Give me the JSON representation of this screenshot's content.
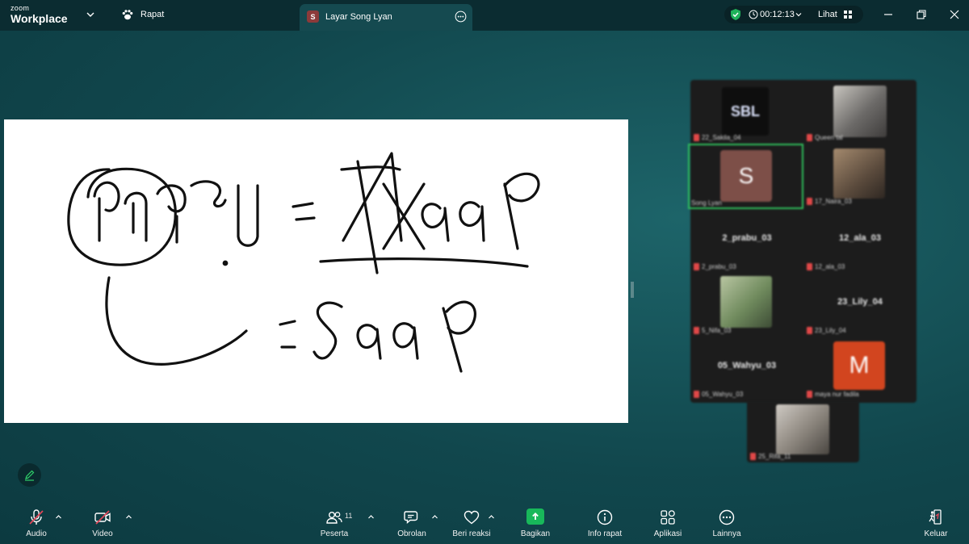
{
  "app": {
    "brand_top": "zoom",
    "brand_bottom": "Workplace",
    "meeting_tab": "Rapat",
    "share_tab": {
      "avatar_letter": "S",
      "label": "Layar Song Lyan"
    },
    "timer": "00:12:13",
    "view_label": "Lihat"
  },
  "whiteboard": {
    "lines": [
      "ករ​ការ​ = Thraap",
      "= Saap"
    ]
  },
  "gallery": {
    "tiles": [
      {
        "name": "22_Sakila_04",
        "logo_text": "SBL"
      },
      {
        "name": "Queen tal"
      },
      {
        "name": "Song Lyan",
        "avatar_letter": "S",
        "active": true
      },
      {
        "name": "17_Naira_03"
      },
      {
        "name": "2_prabu_03",
        "display": "2_prabu_03"
      },
      {
        "name": "12_ala_03",
        "display": "12_ala_03"
      },
      {
        "name": "5_Nifa_03"
      },
      {
        "name": "23_Lily_04",
        "display": "23_Lily_04"
      },
      {
        "name": "05_Wahyu_03",
        "display": "05_Wahyu_03"
      },
      {
        "name": "maya nur fadila",
        "avatar_letter": "M"
      },
      {
        "name": "25_Rifa_11"
      }
    ]
  },
  "toolbar": {
    "audio": "Audio",
    "video": "Video",
    "participants": "Peserta",
    "participants_count": "11",
    "chat": "Obrolan",
    "react": "Beri reaksi",
    "share": "Bagikan",
    "info": "Info rapat",
    "apps": "Aplikasi",
    "more": "Lainnya",
    "leave": "Keluar"
  },
  "colors": {
    "titlebar": "#0b2c31",
    "share_green": "#18b85a",
    "active_outline": "#2fbf5c",
    "mute_red": "#e0485a"
  }
}
